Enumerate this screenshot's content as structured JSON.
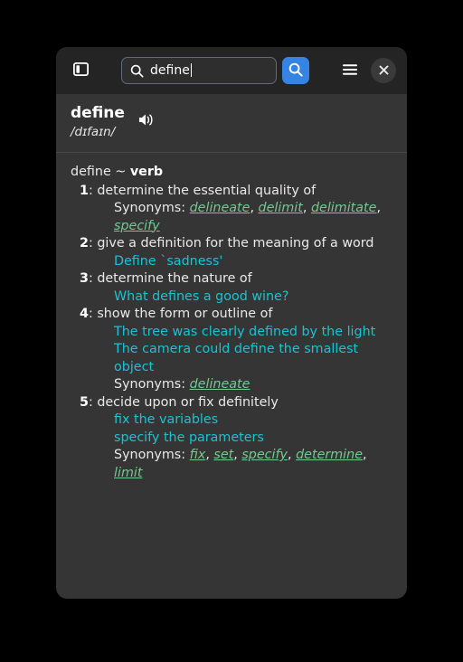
{
  "toolbar": {
    "sidebar_toggle_name": "sidebar-toggle-icon",
    "search": {
      "value": "define",
      "placeholder": "Search"
    },
    "search_button_label": "search-icon",
    "menu_button_label": "hamburger-menu-icon",
    "close_button_label": "✕"
  },
  "entry": {
    "headword": "define",
    "pronunciation": "/dɪfaɪn/",
    "speak_label": "speaker-icon"
  },
  "article": {
    "lemma": "define ~ ",
    "part_of_speech": "verb",
    "senses": [
      {
        "num": "1",
        "definition": ": determine the essential quality of",
        "examples": [],
        "synonyms_label": "Synonyms: ",
        "synonyms": [
          "delineate",
          "delimit",
          "delimitate",
          "specify"
        ]
      },
      {
        "num": "2",
        "definition": ": give a definition for the meaning of a word",
        "examples": [
          "Define `sadness'"
        ],
        "synonyms_label": "",
        "synonyms": []
      },
      {
        "num": "3",
        "definition": ": determine the nature of",
        "examples": [
          "What defines a good wine?"
        ],
        "synonyms_label": "",
        "synonyms": []
      },
      {
        "num": "4",
        "definition": ": show the form or outline of",
        "examples": [
          "The tree was clearly defined by the light",
          "The camera could define the smallest object"
        ],
        "synonyms_label": "Synonyms: ",
        "synonyms": [
          "delineate"
        ]
      },
      {
        "num": "5",
        "definition": ": decide upon or fix definitely",
        "examples": [
          "fix the variables",
          "specify the parameters"
        ],
        "synonyms_label": "Synonyms: ",
        "synonyms": [
          "fix",
          "set",
          "specify",
          "determine",
          "limit"
        ]
      }
    ]
  },
  "colors": {
    "accent_blue": "#3584e4",
    "example_cyan": "#19c3d4",
    "synonym_green": "#73c990",
    "window_bg": "#353535",
    "toolbar_bg": "#242424",
    "text": "#e9e9e9"
  }
}
